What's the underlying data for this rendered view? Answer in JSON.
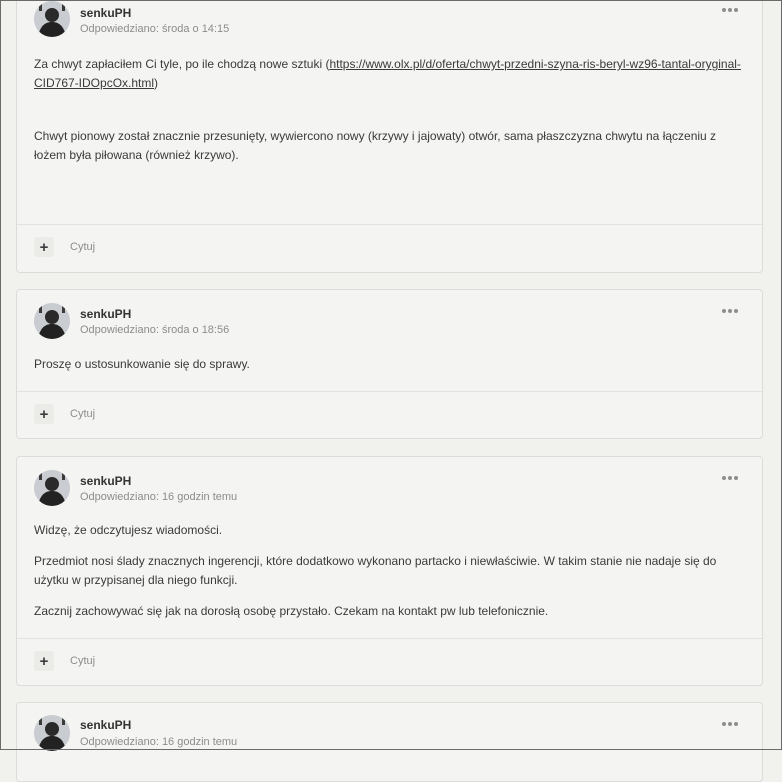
{
  "posts": [
    {
      "author": "senkuPH",
      "meta": "Odpowiedziano: środa o 14:15",
      "paragraphs": [
        "Za chwyt zapłaciłem Ci tyle, po ile chodzą nowe sztuki (",
        ")",
        "Chwyt pionowy został znacznie przesunięty, wywiercono nowy (krzywy i jajowaty) otwór, sama płaszczyzna chwytu na łączeniu z łożem była piłowana (również krzywo)."
      ],
      "link": "https://www.olx.pl/d/oferta/chwyt-przedni-szyna-ris-beryl-wz96-tantal-oryginal-CID767-IDOpcOx.html",
      "quote_label": "Cytuj"
    },
    {
      "author": "senkuPH",
      "meta": "Odpowiedziano: środa o 18:56",
      "paragraphs": [
        "Proszę o ustosunkowanie się do sprawy."
      ],
      "quote_label": "Cytuj"
    },
    {
      "author": "senkuPH",
      "meta": "Odpowiedziano: 16 godzin temu",
      "paragraphs": [
        "Widzę, że odczytujesz wiadomości.",
        "Przedmiot nosi ślady znacznych ingerencji, które dodatkowo wykonano partacko i niewłaściwie. W takim stanie nie nadaje się do użytku w przypisanej dla niego funkcji.",
        "Zacznij zachowywać się jak na dorosłą osobę przystało. Czekam na kontakt pw lub telefonicznie."
      ],
      "quote_label": "Cytuj"
    },
    {
      "author": "senkuPH",
      "meta": "Odpowiedziano: 16 godzin temu"
    }
  ],
  "icons": {
    "more": "more-horizontal-icon",
    "plus": "plus-icon"
  },
  "colors": {
    "background": "#f1f1ee",
    "card": "#f4f4f2",
    "border": "#dcdcd8",
    "muted_text": "#8c8c8c"
  }
}
